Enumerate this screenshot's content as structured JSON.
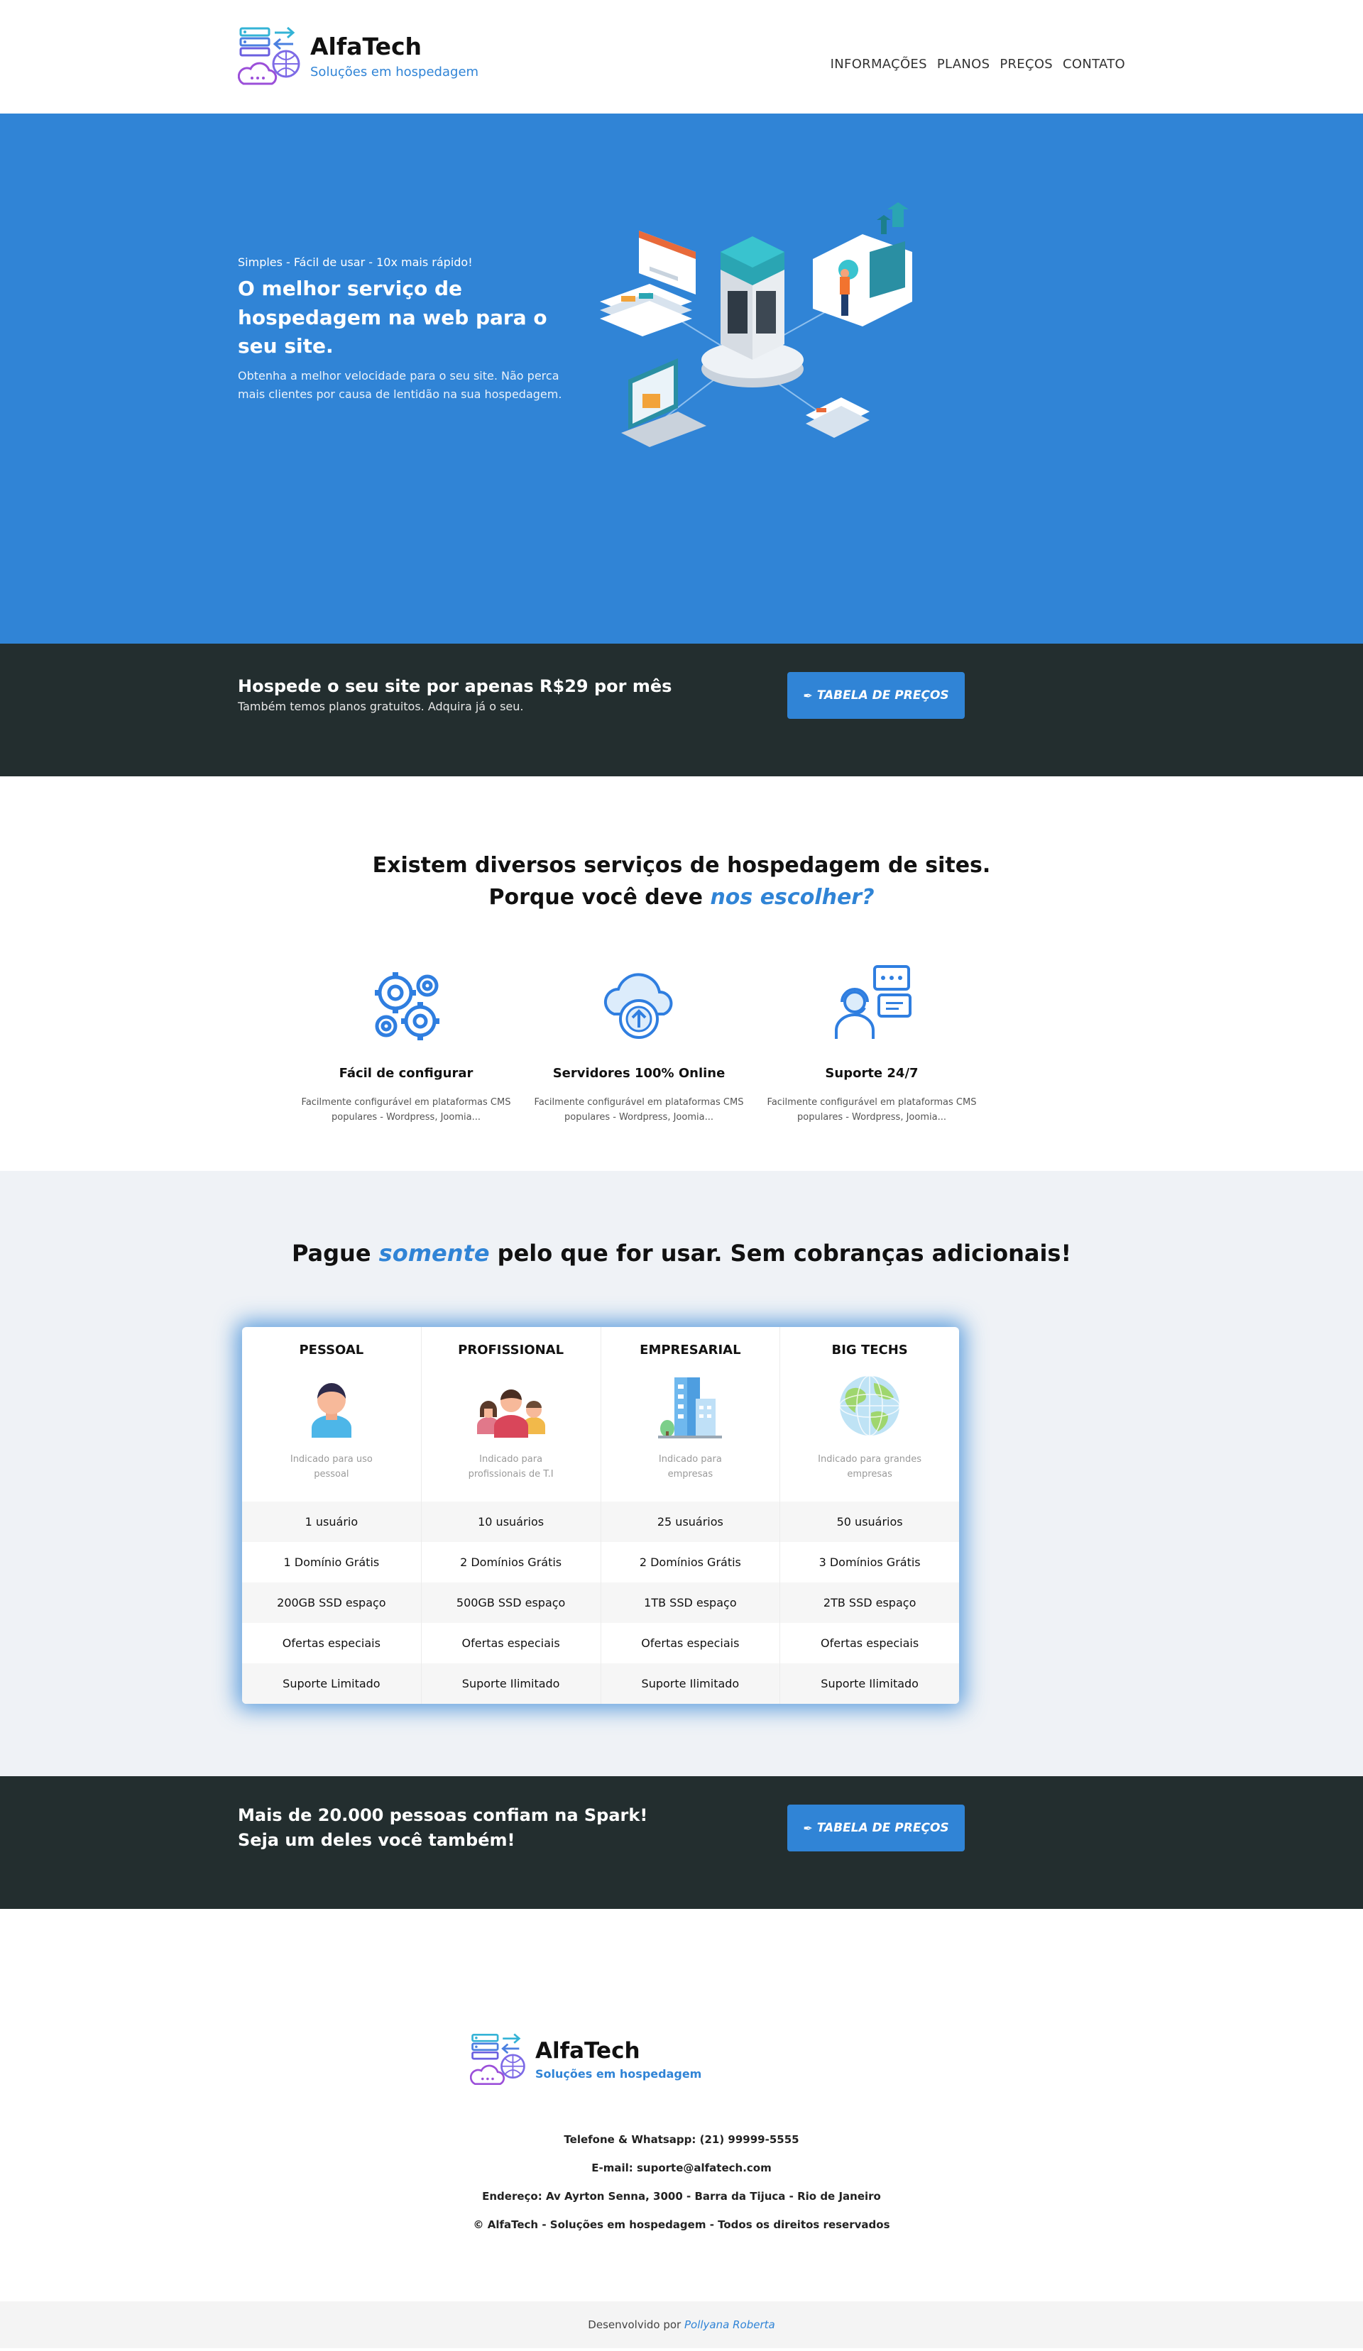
{
  "header": {
    "brand_name": "AlfaTech",
    "brand_tagline": "Soluções em hospedagem",
    "nav": [
      "INFORMAÇÕES",
      "PLANOS",
      "PREÇOS",
      "CONTATO"
    ]
  },
  "hero": {
    "kicker": "Simples - Fácil de usar - 10x mais rápido!",
    "title": "O melhor serviço de hospedagem na web para o seu site.",
    "description": "Obtenha a melhor velocidade para o seu site. Não perca mais clientes por causa de lentidão na sua hospedagem."
  },
  "cta_banner": {
    "title": "Hospede o seu site por apenas R$29 por mês",
    "subtitle": "Também temos planos gratuitos. Adquira já o seu.",
    "button_label": "TABELA DE PREÇOS"
  },
  "why": {
    "title_line1": "Existem diversos serviços de hospedagem de sites.",
    "title_line2_prefix": "Porque você deve ",
    "title_line2_accent": "nos escolher?",
    "features": [
      {
        "title": "Fácil de configurar",
        "description": "Facilmente configurável em plataformas CMS populares - Wordpress, Joomia..."
      },
      {
        "title": "Servidores 100% Online",
        "description": "Facilmente configurável em plataformas CMS populares - Wordpress, Joomia..."
      },
      {
        "title": "Suporte 24/7",
        "description": "Facilmente configurável em plataformas CMS populares - Wordpress, Joomia..."
      }
    ]
  },
  "pricing": {
    "title_prefix": "Pague ",
    "title_accent": "somente",
    "title_suffix": " pelo que for usar. Sem cobranças adicionais!",
    "plans": [
      {
        "name": "PESSOAL",
        "description": "Indicado para uso pessoal"
      },
      {
        "name": "PROFISSIONAL",
        "description": "Indicado para profissionais de T.I"
      },
      {
        "name": "EMPRESARIAL",
        "description": "Indicado para empresas"
      },
      {
        "name": "BIG TECHS",
        "description": "Indicado para grandes empresas"
      }
    ],
    "rows": [
      [
        "1 usuário",
        "10 usuários",
        "25 usuários",
        "50 usuários"
      ],
      [
        "1 Domínio Grátis",
        "2 Domínios Grátis",
        "2 Domínios Grátis",
        "3 Domínios Grátis"
      ],
      [
        "200GB SSD espaço",
        "500GB SSD espaço",
        "1TB SSD espaço",
        "2TB SSD espaço"
      ],
      [
        "Ofertas especiais",
        "Ofertas especiais",
        "Ofertas especiais",
        "Ofertas especiais"
      ],
      [
        "Suporte Limitado",
        "Suporte Ilimitado",
        "Suporte Ilimitado",
        "Suporte Ilimitado"
      ]
    ]
  },
  "trust_banner": {
    "title": "Mais de 20.000 pessoas confiam na Spark! Seja um deles você também!",
    "button_label": "TABELA DE PREÇOS"
  },
  "footer": {
    "brand_name": "AlfaTech",
    "brand_tagline": "Soluções em hospedagem",
    "phone": "Telefone & Whatsapp: (21) 99999-5555",
    "email": "E-mail: suporte@alfatech.com",
    "address": "Endereço: Av Ayrton Senna, 3000 - Barra da Tijuca - Rio de Janeiro",
    "copyright": "© AlfaTech - Soluções em hospedagem - Todos os direitos reservados",
    "dev_prefix": "Desenvolvido por ",
    "dev_name": "Pollyana Roberta"
  },
  "colors": {
    "primary": "#3084d6",
    "dark": "#232e2f",
    "light_bg": "#eff2f6"
  },
  "icons": {
    "logo": "server-cloud-logo-icon",
    "button": "pen-icon",
    "features": [
      "gears-icon",
      "cloud-upload-icon",
      "support-agent-icon"
    ],
    "plans": [
      "person-icon",
      "team-icon",
      "building-icon",
      "globe-icon"
    ]
  }
}
